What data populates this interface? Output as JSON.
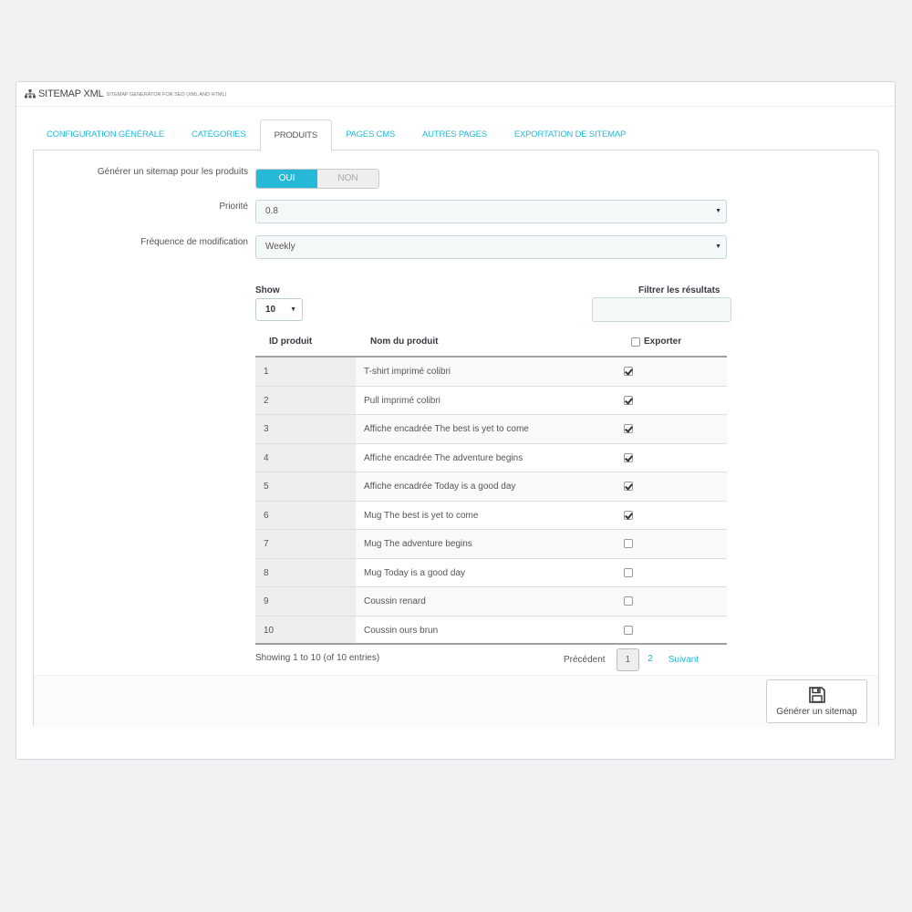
{
  "header": {
    "title": "SITEMAP XML",
    "subtitle": "SITEMAP GENERATOR FOR SEO (XML AND HTML)"
  },
  "tabs": [
    {
      "label": "CONFIGURATION GÉNÉRALE"
    },
    {
      "label": "CATÉGORIES"
    },
    {
      "label": "PRODUITS"
    },
    {
      "label": "PAGES CMS"
    },
    {
      "label": "AUTRES PAGES"
    },
    {
      "label": "EXPORTATION DE SITEMAP"
    }
  ],
  "form": {
    "generate_label": "Générer un sitemap pour les produits",
    "toggle_on": "OUI",
    "toggle_off": "NON",
    "priority_label": "Priorité",
    "priority_value": "0.8",
    "frequency_label": "Fréquence de modification",
    "frequency_value": "Weekly"
  },
  "table": {
    "show_label": "Show",
    "show_value": "10",
    "filter_label": "Filtrer les résultats",
    "columns": {
      "id": "ID produit",
      "name": "Nom du produit",
      "export": "Exporter"
    },
    "rows": [
      {
        "id": "1",
        "name": "T-shirt imprimé colibri",
        "checked": true
      },
      {
        "id": "2",
        "name": "Pull imprimé colibri",
        "checked": true
      },
      {
        "id": "3",
        "name": "Affiche encadrée The best is yet to come",
        "checked": true
      },
      {
        "id": "4",
        "name": "Affiche encadrée The adventure begins",
        "checked": true
      },
      {
        "id": "5",
        "name": "Affiche encadrée Today is a good day",
        "checked": true
      },
      {
        "id": "6",
        "name": "Mug The best is yet to come",
        "checked": true
      },
      {
        "id": "7",
        "name": "Mug The adventure begins",
        "checked": false
      },
      {
        "id": "8",
        "name": "Mug Today is a good day",
        "checked": false
      },
      {
        "id": "9",
        "name": "Coussin renard",
        "checked": false
      },
      {
        "id": "10",
        "name": "Coussin ours brun",
        "checked": false
      }
    ],
    "showing": "Showing 1 to 10 (of 10 entries)",
    "pager": {
      "prev": "Précédent",
      "pages": [
        "1",
        "2"
      ],
      "next": "Suivant"
    }
  },
  "actions": {
    "generate_button": "Générer un sitemap"
  },
  "colors": {
    "accent": "#25b9d7",
    "background": "#eff1f2"
  }
}
